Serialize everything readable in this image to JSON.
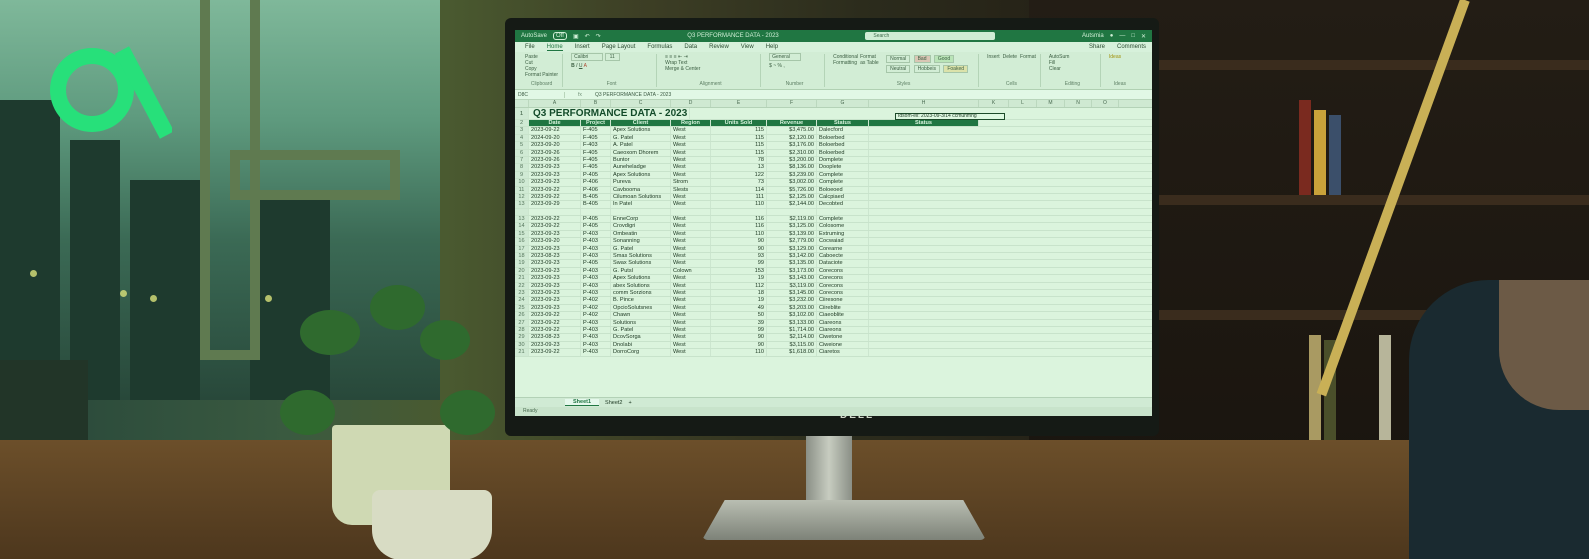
{
  "app": {
    "autosave_label": "AutoSave",
    "autosave_state": "Off",
    "doc_title": "Q3 PERFORMANCE DATA - 2023",
    "search_placeholder": "Search",
    "user": "Autsmia",
    "share_label": "Share",
    "comments_label": "Comments",
    "window_controls": [
      "—",
      "□",
      "✕"
    ]
  },
  "menu": [
    "File",
    "Home",
    "Insert",
    "Page Layout",
    "Formulas",
    "Data",
    "Review",
    "View",
    "Help"
  ],
  "ribbon": {
    "clipboard": {
      "label": "Clipboard",
      "items": [
        "Paste",
        "Cut",
        "Copy",
        "Format Painter"
      ]
    },
    "font": {
      "label": "Font",
      "font_name": "Calibri",
      "font_size": "11"
    },
    "alignment": {
      "label": "Alignment",
      "items": [
        "Wrap Text",
        "Merge & Center"
      ]
    },
    "number": {
      "label": "Number",
      "format": "General"
    },
    "styles": {
      "label": "Styles",
      "items": [
        "Conditional Formatting",
        "Format as Table"
      ],
      "chips": [
        "Normal",
        "Bad",
        "Good",
        "Neutral",
        "Hobbeis",
        "Foaked"
      ]
    },
    "cells": {
      "label": "Cells",
      "items": [
        "Insert",
        "Delete",
        "Format"
      ]
    },
    "editing": {
      "label": "Editing",
      "items": [
        "AutoSum",
        "Fill",
        "Clear",
        "Sort & Filter",
        "Find & Select"
      ]
    },
    "ideas": {
      "label": "Ideas",
      "items": [
        "Ideas"
      ]
    }
  },
  "formula_bar": {
    "name_box": "D8C",
    "fx": "fx",
    "content": "Q3 PERFORMANCE DATA - 2023"
  },
  "columns": [
    "A",
    "B",
    "C",
    "D",
    "E",
    "F",
    "G",
    "H",
    "K",
    "L",
    "M",
    "N",
    "O"
  ],
  "sheet": {
    "title": "Q3 PERFORMANCE DATA - 2023",
    "headers": [
      "Date",
      "Project",
      "Client",
      "Region",
      "Units Sold",
      "Revenue",
      "Status",
      "Status"
    ],
    "rows": [
      [
        "2023-09-22",
        "F-405",
        "Apex Solutions",
        "West",
        "115",
        "$3,475.00",
        "Dalecford"
      ],
      [
        "2024-09-20",
        "F-405",
        "G. Patel",
        "West",
        "115",
        "$2,120.00",
        "Boloerbed"
      ],
      [
        "2023-09-20",
        "F-403",
        "A. Patel",
        "West",
        "115",
        "$3,176.00",
        "Boloerbed"
      ],
      [
        "2023-09-26",
        "F-405",
        "Caeoxom Dhorem",
        "West",
        "115",
        "$2,310.00",
        "Boloerbed"
      ],
      [
        "2023-09-26",
        "F-405",
        "Buntor",
        "West",
        "78",
        "$3,200.00",
        "Domplete"
      ],
      [
        "2023-09-23",
        "F-405",
        "Auneheladge",
        "West",
        "13",
        "$8,136.00",
        "Dooplete"
      ],
      [
        "2023-09-23",
        "P-405",
        "Apex Solutions",
        "West",
        "122",
        "$3,239.00",
        "Complete"
      ],
      [
        "2023-09-23",
        "P-406",
        "Pureva",
        "Strom",
        "73",
        "$3,002.00",
        "Complete"
      ],
      [
        "2023-09-22",
        "P-406",
        "Cavbooma",
        "Slests",
        "114",
        "$5,726.00",
        "Boloeoed"
      ],
      [
        "2023-09-22",
        "B-405",
        "Cilumoan Solutions",
        "West",
        "111",
        "$2,125.00",
        "Calcpiaed"
      ],
      [
        "2023-09-29",
        "B-405",
        "In Patel",
        "West",
        "110",
        "$2,144.00",
        "Decobted"
      ],
      [
        "",
        "",
        "",
        "",
        "",
        "",
        ""
      ],
      [
        "2023-09-22",
        "P-405",
        "EnneCorp",
        "West",
        "116",
        "$2,119.00",
        "Complete"
      ],
      [
        "2023-09-22",
        "P-405",
        "Crovdigri",
        "West",
        "116",
        "$3,125.00",
        "Colosome"
      ],
      [
        "2023-09-23",
        "P-403",
        "Ombeatin",
        "West",
        "110",
        "$3,139.00",
        "Extruming"
      ],
      [
        "2023-09-20",
        "P-403",
        "Sonanning",
        "West",
        "90",
        "$2,779.00",
        "Cocwaiad"
      ],
      [
        "2023-09-23",
        "P-403",
        "G. Patel",
        "West",
        "90",
        "$3,129.00",
        "Corearne"
      ],
      [
        "2023-08-23",
        "P-403",
        "Smas Solutions",
        "West",
        "93",
        "$3,142.00",
        "Caboecte"
      ],
      [
        "2023-09-23",
        "P-405",
        "Swax Solutions",
        "West",
        "99",
        "$3,135.00",
        "Dataciote"
      ],
      [
        "2023-09-23",
        "P-403",
        "G. Putsl",
        "Colown",
        "153",
        "$3,173.00",
        "Corecons"
      ],
      [
        "2023-09-23",
        "P-403",
        "Apex Solutions",
        "West",
        "19",
        "$3,143.00",
        "Corecons"
      ],
      [
        "2023-09-23",
        "P-403",
        "abex Solutions",
        "West",
        "112",
        "$3,119.00",
        "Corecons"
      ],
      [
        "2023-09-23",
        "P-403",
        "comm Sorzions",
        "West",
        "18",
        "$3,145.00",
        "Corecons"
      ],
      [
        "2023-09-23",
        "P-402",
        "B. Pince",
        "West",
        "19",
        "$3,232.00",
        "Ciiresone"
      ],
      [
        "2023-09-23",
        "P-402",
        "OpcioSolutsnes",
        "West",
        "49",
        "$3,203.00",
        "Ciireblite"
      ],
      [
        "2023-09-22",
        "P-402",
        "Chawn",
        "West",
        "50",
        "$3,102.00",
        "Ciaeoblite"
      ],
      [
        "2023-09-22",
        "P-403",
        "Solutions",
        "West",
        "39",
        "$3,133.00",
        "Ciareons"
      ],
      [
        "2023-09-22",
        "P-403",
        "G. Patel",
        "West",
        "99",
        "$1,714.00",
        "Ciareons"
      ],
      [
        "2023-08-23",
        "P-403",
        "DcovSorga",
        "West",
        "90",
        "$2,114.00",
        "Ciwetone"
      ],
      [
        "2023-09-23",
        "P-403",
        "Dnolabi",
        "West",
        "90",
        "$3,115.00",
        "Ciweione"
      ],
      [
        "2023-09-22",
        "P-403",
        "DorroCorg",
        "West",
        "110",
        "$1,618.00",
        "Ciaretos"
      ]
    ],
    "row_numbers": [
      "3",
      "4",
      "5",
      "6",
      "7",
      "8",
      "9",
      "10",
      "11",
      "12",
      "13",
      "",
      "13",
      "14",
      "15",
      "16",
      "17",
      "18",
      "19",
      "20",
      "21",
      "22",
      "23",
      "24",
      "25",
      "26",
      "27",
      "28",
      "29",
      "30",
      "21"
    ],
    "note": "Idsom-eil: 2023-09-3/14 ccmunmng"
  },
  "sheet_tabs": [
    "Sheet1",
    "Sheet2",
    "+"
  ],
  "status_text": "Ready",
  "monitor_brand": "DELL"
}
